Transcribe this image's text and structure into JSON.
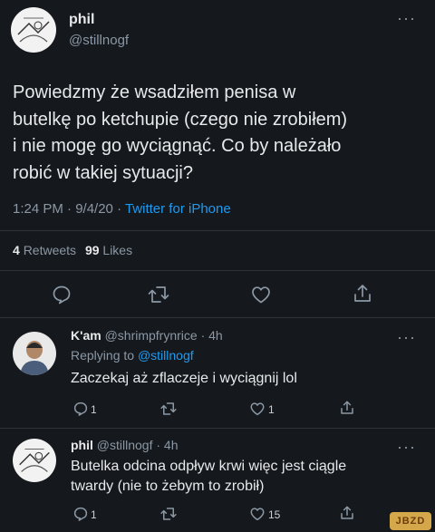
{
  "main_tweet": {
    "display_name": "phil",
    "handle": "@stillnogf",
    "text_lines": [
      "Powiedzmy że wsadziłem penisa w",
      "butelkę po ketchupie (czego nie zrobiłem)",
      "i nie mogę go wyciągnąć. Co by należało",
      "robić w takiej sytuacji?"
    ],
    "time": "1:24 PM · 9/4/20 · ",
    "source": "Twitter for iPhone",
    "retweets_count": "4",
    "retweets_label": "Retweets",
    "likes_count": "99",
    "likes_label": "Likes",
    "more_label": "···"
  },
  "reply_1": {
    "display_name": "K'am",
    "meta": "@shrimpfrynrice · 4h",
    "replying_to_prefix": "Replying to ",
    "replying_to_handle": "@stillnogf",
    "text": "Zaczekaj aż zflaczeje i wyciągnij lol",
    "reply_count": "1",
    "like_count": "1",
    "more_label": "···"
  },
  "reply_2": {
    "display_name": "phil",
    "meta": "@stillnogf · 4h",
    "text_lines": [
      "Butelka odcina odpływ krwi więc jest ciągle",
      "twardy (nie to żebym to zrobił)"
    ],
    "reply_count": "1",
    "like_count": "15",
    "more_label": "···"
  },
  "watermark": "JBZD",
  "colors": {
    "background": "#15181c",
    "link": "#1d9bf0",
    "muted": "#8b98a5"
  }
}
